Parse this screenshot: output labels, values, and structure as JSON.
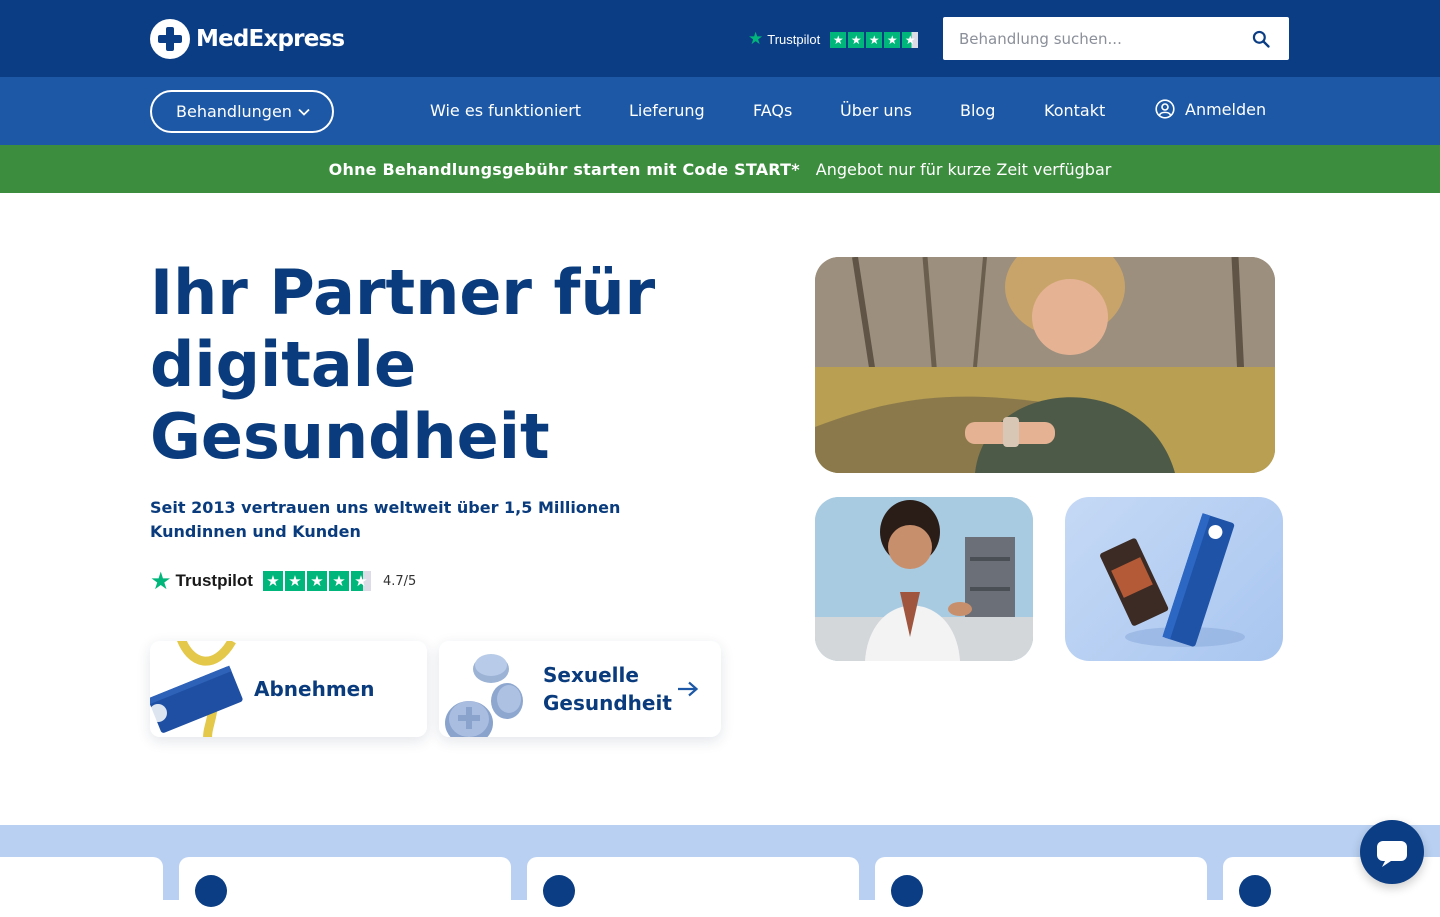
{
  "header": {
    "logo_text": "MedExpress",
    "trustpilot_label": "Trustpilot",
    "search": {
      "placeholder": "Behandlung suchen..."
    }
  },
  "nav": {
    "treatments_label": "Behandlungen",
    "links": [
      "Wie es funktioniert",
      "Lieferung",
      "FAQs",
      "Über uns",
      "Blog",
      "Kontakt"
    ],
    "login_label": "Anmelden"
  },
  "promo": {
    "bold": "Ohne Behandlungsgebühr starten mit Code START*",
    "normal": "Angebot nur für kurze Zeit verfügbar"
  },
  "hero": {
    "title": "Ihr Partner für digitale Gesundheit",
    "subtitle": "Seit 2013 vertrauen uns weltweit über 1,5 Millionen Kundinnen und Kunden",
    "trustpilot_label": "Trustpilot",
    "rating": "4.7/5"
  },
  "categories": [
    {
      "label": "Abnehmen"
    },
    {
      "label": "Sexuelle Gesundheit"
    }
  ],
  "icons": {
    "search": "search-icon",
    "chevron": "chevron-down-icon",
    "user": "user-circle-icon",
    "arrow": "arrow-right-icon",
    "chat": "chat-icon"
  },
  "colors": {
    "header_bg": "#0b3d84",
    "nav_bg": "#1c58a6",
    "promo_bg": "#3d8d3f",
    "trustpilot_green": "#00b67a",
    "title_text": "#0a3c7d",
    "band_bg": "#b9d0f2"
  }
}
